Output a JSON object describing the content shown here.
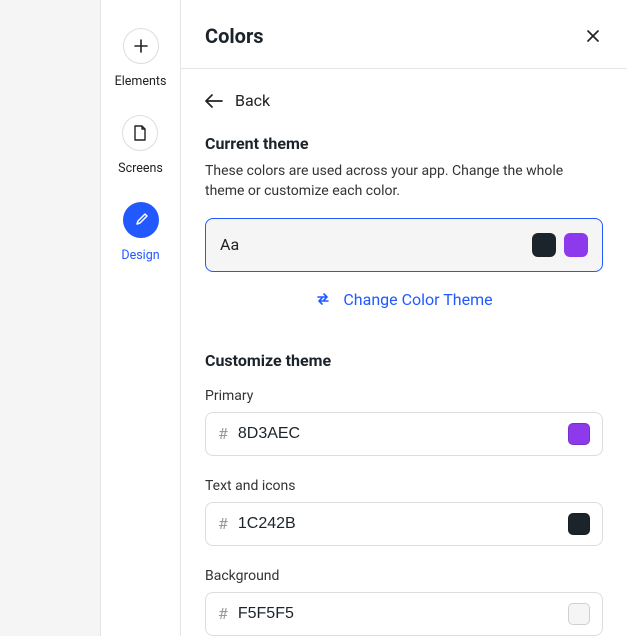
{
  "sidebar": {
    "items": [
      {
        "label": "Elements"
      },
      {
        "label": "Screens"
      },
      {
        "label": "Design"
      }
    ]
  },
  "panel": {
    "title": "Colors",
    "back_label": "Back",
    "current_theme": {
      "heading": "Current theme",
      "description": "These colors are used across your app. Change the whole theme or customize each color.",
      "sample_text": "Aa",
      "swatches": {
        "text": "#1c242b",
        "primary": "#8d3aec"
      },
      "change_label": "Change Color Theme"
    },
    "customize": {
      "heading": "Customize theme",
      "fields": [
        {
          "label": "Primary",
          "value": "8D3AEC",
          "chip": "#8d3aec"
        },
        {
          "label": "Text and icons",
          "value": "1C242B",
          "chip": "#1c242b"
        },
        {
          "label": "Background",
          "value": "F5F5F5",
          "chip": "#f5f5f5"
        }
      ]
    }
  }
}
